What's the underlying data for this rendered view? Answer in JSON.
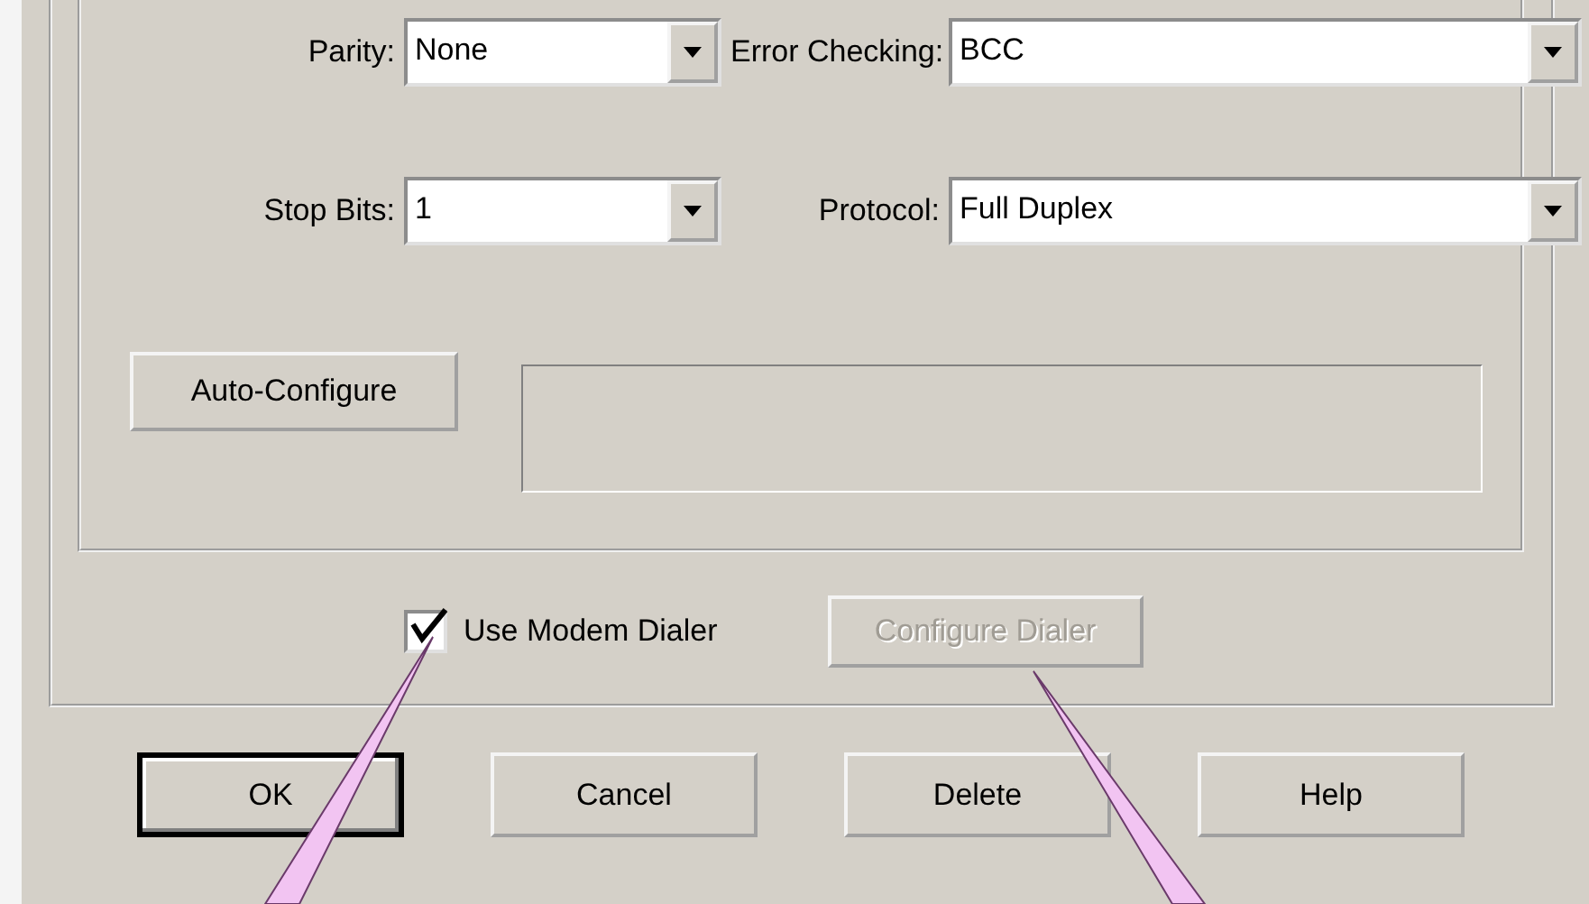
{
  "fields": [
    {
      "label": "Parity:",
      "value": "None"
    },
    {
      "label": "Error Checking:",
      "value": "BCC"
    },
    {
      "label": "Stop Bits:",
      "value": "1"
    },
    {
      "label": "Protocol:",
      "value": "Full Duplex"
    }
  ],
  "auto_configure_button": {
    "label": "Auto-Configure"
  },
  "modem_dialer": {
    "label": "Use Modem Dialer",
    "checked": true
  },
  "configure_dialer_button": {
    "label": "Configure Dialer",
    "disabled": true
  },
  "buttons": [
    {
      "label": "OK",
      "default": true
    },
    {
      "label": "Cancel",
      "default": false
    },
    {
      "label": "Delete",
      "default": false
    },
    {
      "label": "Help",
      "default": false
    }
  ]
}
